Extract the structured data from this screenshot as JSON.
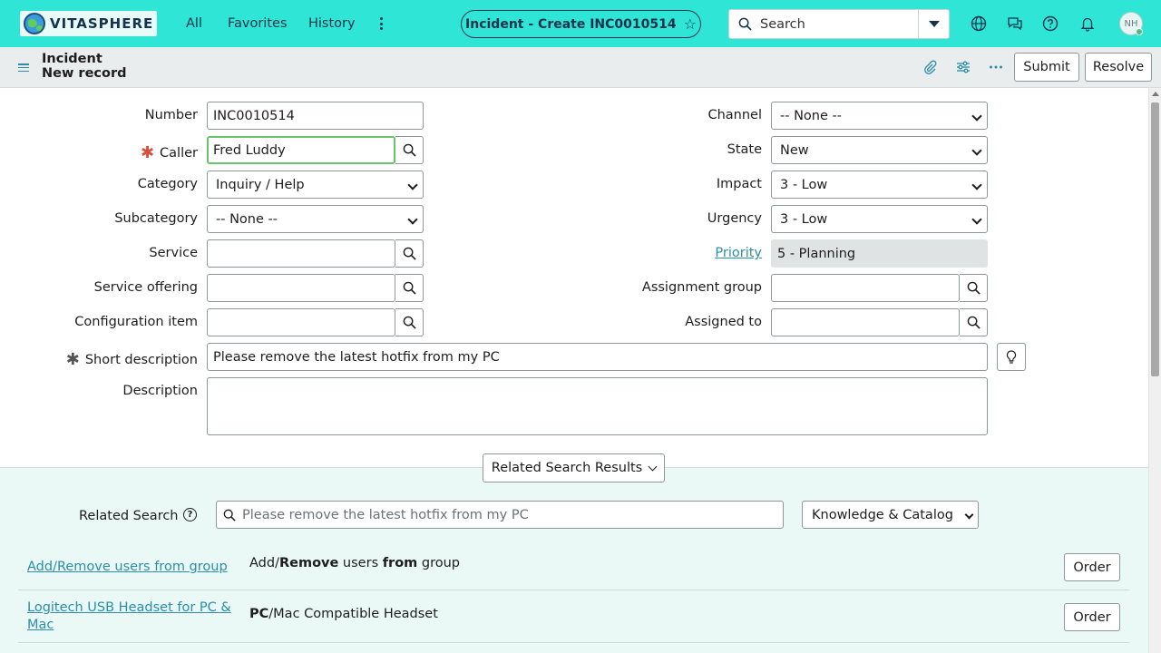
{
  "nav": {
    "logo_text": "VITASPHERE",
    "links": [
      "All",
      "Favorites",
      "History"
    ],
    "context_title": "Incident - Create INC0010514",
    "search_text": "Search",
    "avatar_initials": "NH"
  },
  "header": {
    "title_line1": "Incident",
    "title_line2": "New record",
    "submit_label": "Submit",
    "resolve_label": "Resolve"
  },
  "form": {
    "left": {
      "number": {
        "label": "Number",
        "value": "INC0010514"
      },
      "caller": {
        "label": "Caller",
        "value": "Fred Luddy"
      },
      "category": {
        "label": "Category",
        "value": "Inquiry / Help"
      },
      "subcategory": {
        "label": "Subcategory",
        "value": "-- None --"
      },
      "service": {
        "label": "Service",
        "value": ""
      },
      "service_offering": {
        "label": "Service offering",
        "value": ""
      },
      "configuration_item": {
        "label": "Configuration item",
        "value": ""
      }
    },
    "right": {
      "channel": {
        "label": "Channel",
        "value": "-- None --"
      },
      "state": {
        "label": "State",
        "value": "New"
      },
      "impact": {
        "label": "Impact",
        "value": "3 - Low"
      },
      "urgency": {
        "label": "Urgency",
        "value": "3 - Low"
      },
      "priority": {
        "label": "Priority",
        "value": "5 - Planning"
      },
      "assignment_group": {
        "label": "Assignment group",
        "value": ""
      },
      "assigned_to": {
        "label": "Assigned to",
        "value": ""
      }
    },
    "short_description": {
      "label": "Short description",
      "value": "Please remove the latest hotfix from my PC"
    },
    "description": {
      "label": "Description",
      "value": ""
    }
  },
  "related": {
    "toggle_label": "Related Search Results",
    "search_label": "Related Search",
    "search_placeholder": "Please remove the latest hotfix from my PC",
    "source_select": "Knowledge & Catalog (All)",
    "results": [
      {
        "title": "Add/Remove users from group",
        "desc_parts": [
          [
            "Add/",
            false
          ],
          [
            "Remove",
            true
          ],
          [
            " users ",
            false
          ],
          [
            "from",
            true
          ],
          [
            " group",
            false
          ]
        ],
        "button": "Order"
      },
      {
        "title": "Logitech USB Headset for PC & Mac",
        "desc_parts": [
          [
            "PC",
            true
          ],
          [
            "/Mac Compatible Headset",
            false
          ]
        ],
        "button": "Order"
      }
    ]
  }
}
